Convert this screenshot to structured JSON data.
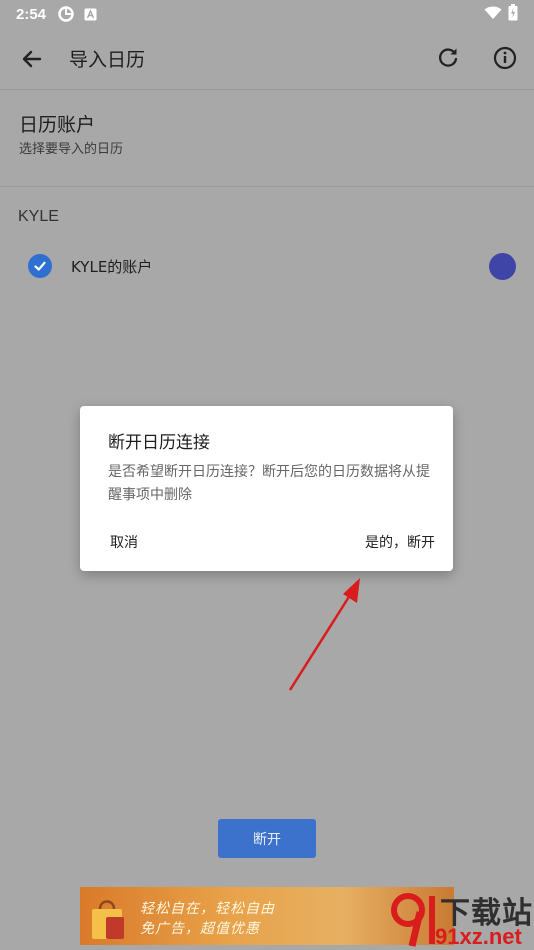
{
  "status_bar": {
    "time": "2:54",
    "icons": [
      "sync-icon",
      "a-box-icon",
      "wifi-icon",
      "battery-icon"
    ]
  },
  "app_bar": {
    "title": "导入日历",
    "back_icon": "arrow-left-icon",
    "refresh_icon": "refresh-icon",
    "info_icon": "info-icon"
  },
  "account_section": {
    "heading": "日历账户",
    "subheading": "选择要导入的日历"
  },
  "group": {
    "label": "KYLE",
    "calendars": [
      {
        "name": "KYLE的账户",
        "checked": true,
        "color": "#3e45a6"
      }
    ]
  },
  "dialog": {
    "title": "断开日历连接",
    "message": "是否希望断开日历连接？断开后您的日历数据将从提醒事项中删除",
    "cancel_label": "取消",
    "confirm_label": "是的，断开"
  },
  "bottom_button": {
    "label": "断开"
  },
  "ad_banner": {
    "line1": "轻松自在，轻松自由",
    "line2": "免广告，超值优惠"
  },
  "watermark": {
    "top": "下载站",
    "bottom": "91xz.net"
  },
  "colors": {
    "accent": "#2f6fd1",
    "calendar_dot": "#3e45a6",
    "scrim": "#a8a8a8",
    "button": "#3d72cc",
    "arrow": "#d91c1c"
  }
}
